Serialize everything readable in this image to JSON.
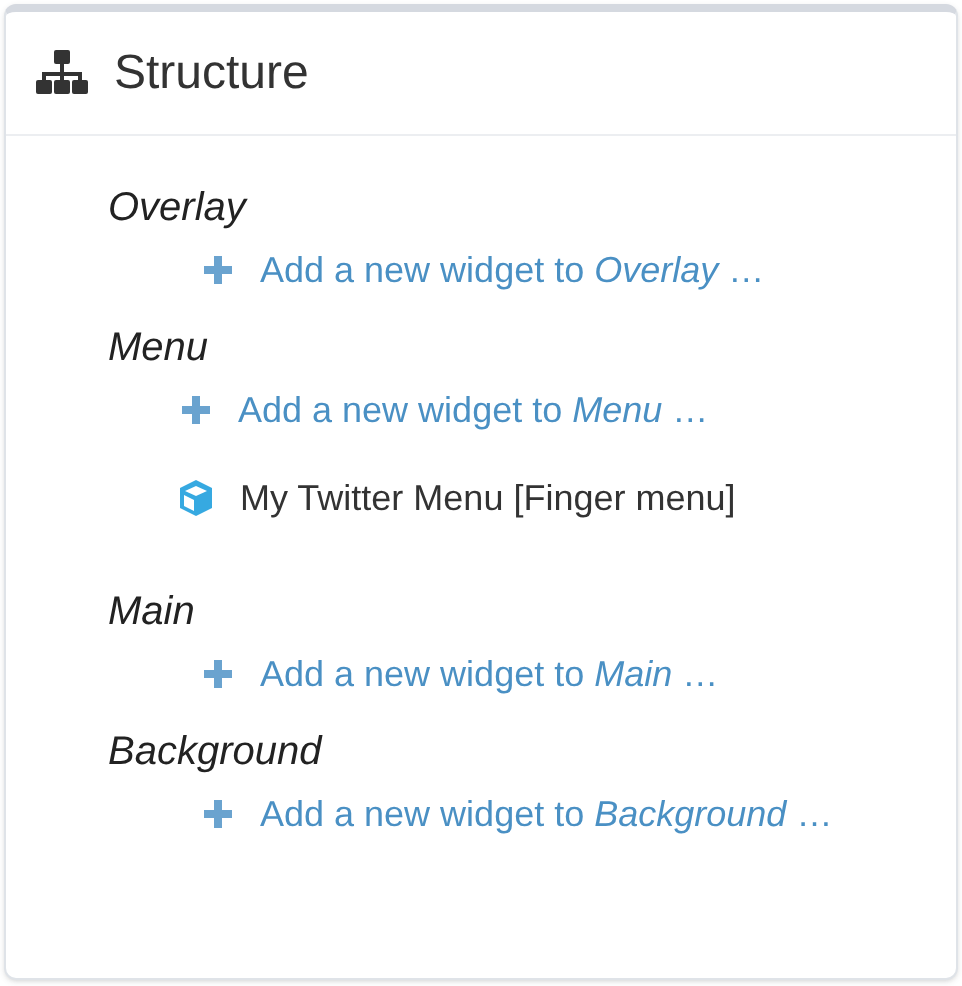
{
  "panel": {
    "title": "Structure"
  },
  "sections": [
    {
      "name": "Overlay",
      "add_link": "Add a new widget to *Overlay* …"
    },
    {
      "name": "Menu",
      "add_link": "Add a new widget to *Menu* …",
      "widgets": [
        "My Twitter Menu [Finger menu]"
      ]
    },
    {
      "name": "Main",
      "add_link": "Add a new widget to *Main* …"
    },
    {
      "name": "Background",
      "add_link": "Add a new widget to *Background* …"
    }
  ]
}
